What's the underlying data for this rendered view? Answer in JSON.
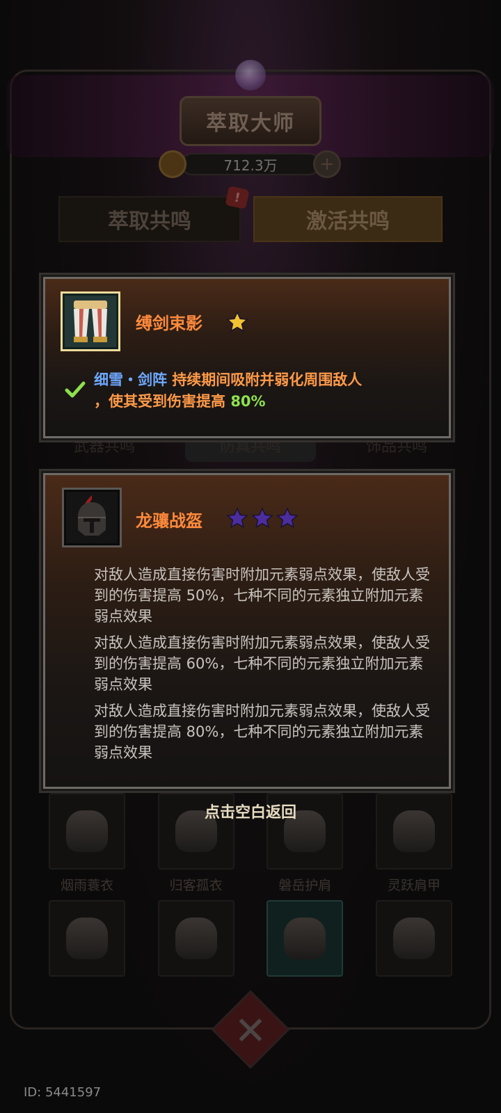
{
  "header": {
    "title": "萃取大师",
    "currency": "712.3万",
    "plus_symbol": "+"
  },
  "tabs": {
    "left": "萃取共鸣",
    "right": "激活共鸣",
    "alert": "!"
  },
  "mid_tabs": [
    "武器共鸣",
    "防具共鸣",
    "饰品共鸣"
  ],
  "grid": {
    "row1": [
      {
        "name": "烟雨蓑衣",
        "stars": "★"
      },
      {
        "name": "归客孤衣",
        "stars": "★★★"
      },
      {
        "name": "磐岳护肩",
        "stars": "★★★"
      },
      {
        "name": "灵跃肩甲",
        "stars": "★★★"
      }
    ]
  },
  "panel1": {
    "item_name": "缚剑束影",
    "star_count": 1,
    "skill_name": "细雪・剑阵",
    "desc_part1": "持续期间吸附并弱化周围敌人",
    "desc_part2": "，使其受到伤害提高",
    "percent": "80%"
  },
  "panel2": {
    "item_name": "龙骧战盔",
    "star_count": 3,
    "descriptions": [
      "对敌人造成直接伤害时附加元素弱点效果，使敌人受到的伤害提高 50%，七种不同的元素独立附加元素弱点效果",
      "对敌人造成直接伤害时附加元素弱点效果，使敌人受到的伤害提高 60%，七种不同的元素独立附加元素弱点效果",
      "对敌人造成直接伤害时附加元素弱点效果，使敌人受到的伤害提高 80%，七种不同的元素独立附加元素弱点效果"
    ]
  },
  "back_hint": "点击空白返回",
  "id_label": "ID: 5441597",
  "colors": {
    "item_name": "#ff8a3c",
    "skill": "#6ea8ff",
    "desc": "#ff9a48",
    "percent": "#8fe14d",
    "star_gold": "#f2c230",
    "star_purple": "#4b2d9e"
  }
}
